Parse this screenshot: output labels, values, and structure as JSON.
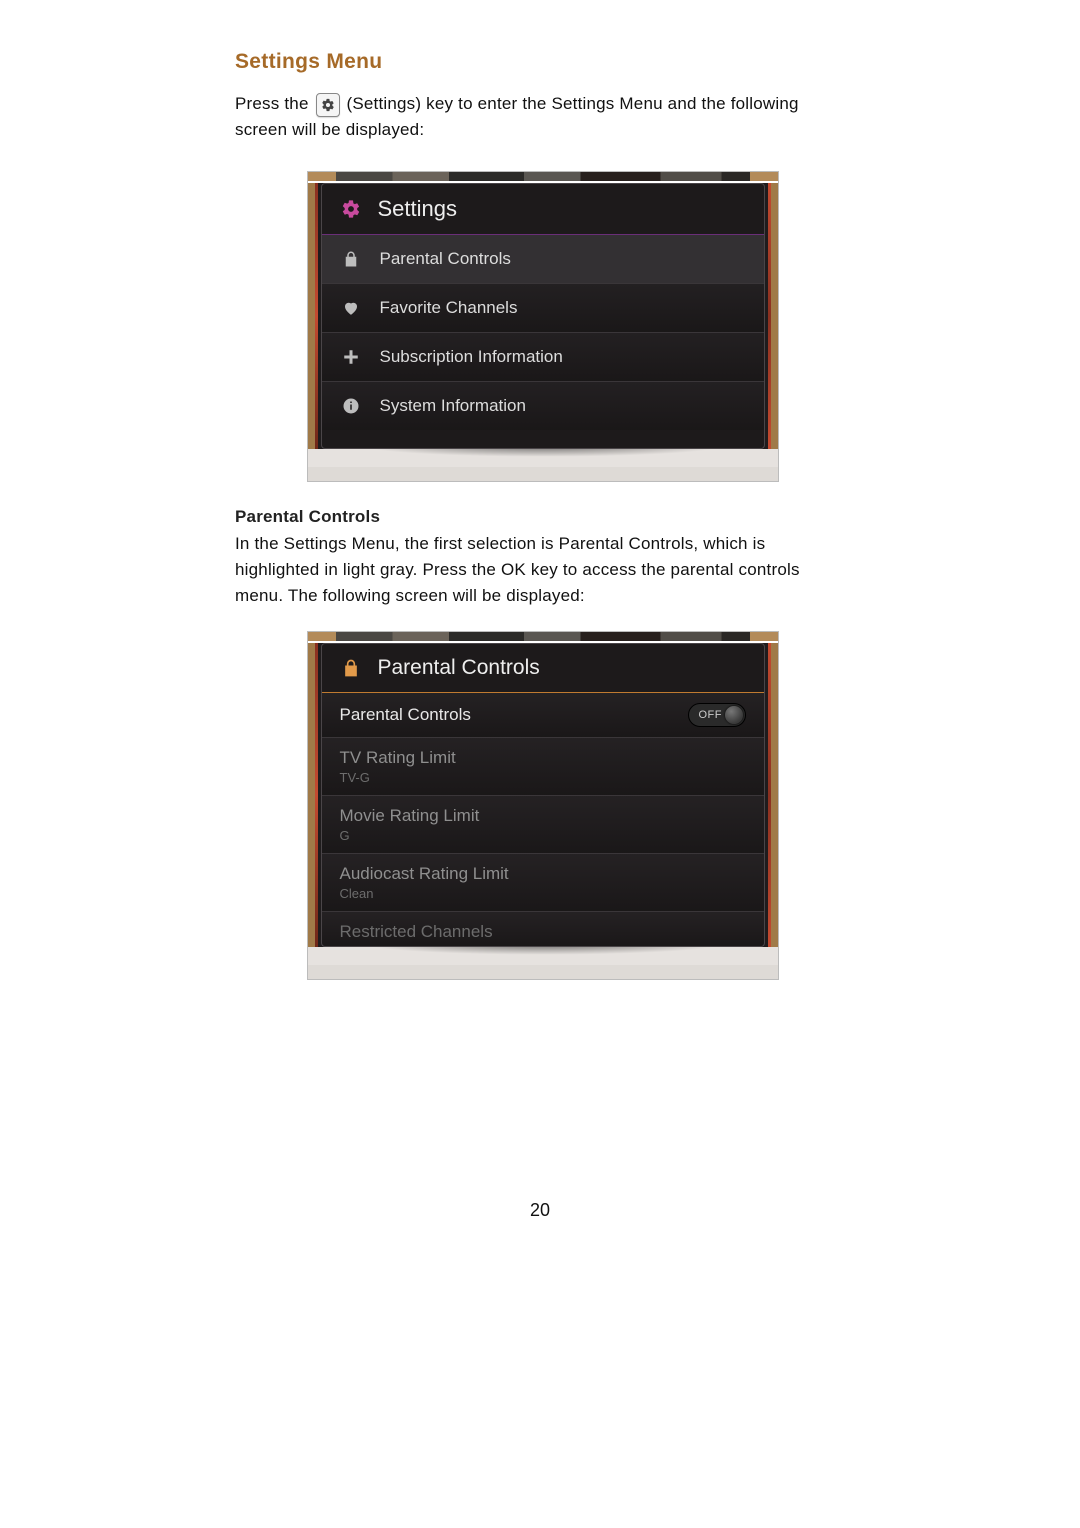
{
  "heading": "Settings Menu",
  "intro_before_icon": "Press the",
  "intro_after_icon": "(Settings) key to enter the Settings Menu and the following screen will be displayed:",
  "settings_panel": {
    "title": "Settings",
    "items": [
      {
        "icon": "lock",
        "label": "Parental Controls"
      },
      {
        "icon": "heart",
        "label": "Favorite Channels"
      },
      {
        "icon": "plus",
        "label": "Subscription Information"
      },
      {
        "icon": "info",
        "label": "System Information"
      }
    ]
  },
  "parental_heading": "Parental Controls",
  "parental_text": "In the Settings Menu, the first selection is Parental Controls, which is highlighted in light gray.  Press the OK key to access the parental controls menu.  The following screen will be displayed:",
  "parental_panel": {
    "title": "Parental Controls",
    "toggle_label": "Parental Controls",
    "toggle_state": "OFF",
    "rows": [
      {
        "title": "TV Rating Limit",
        "sub": "TV-G"
      },
      {
        "title": "Movie Rating Limit",
        "sub": "G"
      },
      {
        "title": "Audiocast Rating Limit",
        "sub": "Clean"
      },
      {
        "title": "Restricted Channels",
        "sub": ""
      }
    ]
  },
  "page_number": "20"
}
